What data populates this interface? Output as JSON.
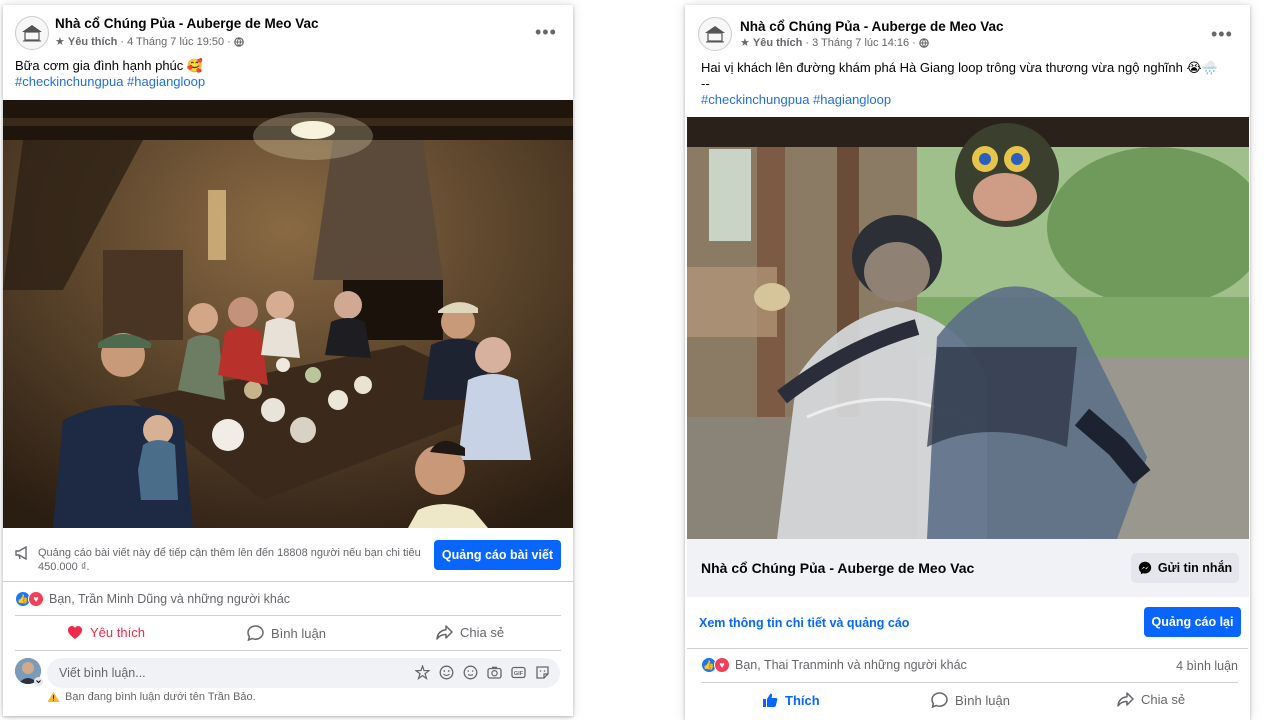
{
  "posts": [
    {
      "page_name": "Nhà cổ Chúng Pủa - Auberge de Meo Vac",
      "favorite_label": "Yêu thích",
      "timestamp": "4 Tháng 7 lúc 19:50",
      "caption": "Bữa cơm gia đình hạnh phúc 🥰",
      "hashtags": "#checkinchungpua #hagiangloop",
      "promo_text": "Quảng cáo bài viết này để tiếp cận thêm lên đến 18808 người nếu bạn chi tiêu 450.000 ₫.",
      "promo_button": "Quảng cáo bài viết",
      "reactions_text": "Bạn, Trần Minh Dũng và những người khác",
      "actions": {
        "like": "Yêu thích",
        "comment": "Bình luận",
        "share": "Chia sẻ"
      },
      "comment_placeholder": "Viết bình luận...",
      "comment_notice": "Bạn đang bình luận dưới tên Trần Bảo."
    },
    {
      "page_name": "Nhà cổ Chúng Pủa - Auberge de Meo Vac",
      "favorite_label": "Yêu thích",
      "timestamp": "3 Tháng 7 lúc 14:16",
      "caption_line1": "Hai vị khách lên đường khám phá Hà Giang loop trông vừa thương vừa ngộ nghĩnh 😭🌧️",
      "caption_line2": "--",
      "hashtags": "#checkinchungpua #hagiangloop",
      "strip_page_name": "Nhà cổ Chúng Pủa - Auberge de Meo Vac",
      "message_button": "Gửi tin nhắn",
      "details_link": "Xem thông tin chi tiết và quảng cáo",
      "promote_again_button": "Quảng cáo lại",
      "reactions_text": "Bạn, Thai Tranminh và những người khác",
      "comments_count": "4 bình luận",
      "actions": {
        "like": "Thích",
        "comment": "Bình luận",
        "share": "Chia sẻ"
      }
    }
  ],
  "colors": {
    "brand_blue": "#0866ff",
    "love_red": "#f02849",
    "hashtag_blue": "#216fdb",
    "muted": "#65676b"
  }
}
